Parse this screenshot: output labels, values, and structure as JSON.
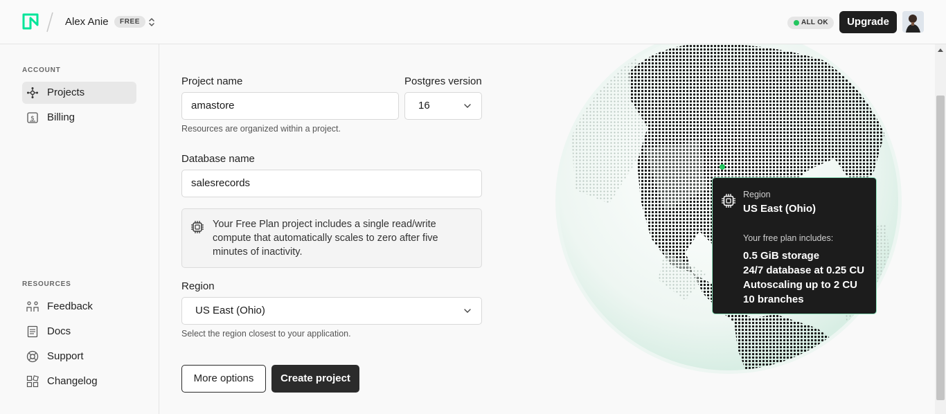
{
  "header": {
    "user_name": "Alex Anie",
    "plan_badge": "FREE",
    "status": "ALL OK",
    "upgrade_label": "Upgrade",
    "accent_color": "#00e599"
  },
  "sidebar": {
    "account_label": "ACCOUNT",
    "account_items": [
      {
        "label": "Projects",
        "icon": "projects-icon",
        "active": true
      },
      {
        "label": "Billing",
        "icon": "billing-icon",
        "active": false
      }
    ],
    "resources_label": "RESOURCES",
    "resource_items": [
      {
        "label": "Feedback",
        "icon": "feedback-icon"
      },
      {
        "label": "Docs",
        "icon": "docs-icon"
      },
      {
        "label": "Support",
        "icon": "support-icon"
      },
      {
        "label": "Changelog",
        "icon": "changelog-icon"
      }
    ]
  },
  "form": {
    "project_name_label": "Project name",
    "project_name_value": "amastore",
    "project_name_hint": "Resources are organized within a project.",
    "postgres_label": "Postgres version",
    "postgres_value": "16",
    "database_name_label": "Database name",
    "database_name_value": "salesrecords",
    "info_text": "Your Free Plan project includes a single read/write compute that automatically scales to zero after five minutes of inactivity.",
    "region_label": "Region",
    "region_value": "US East (Ohio)",
    "region_hint": "Select the region closest to your application.",
    "more_options_label": "More options",
    "create_label": "Create project"
  },
  "tooltip": {
    "label": "Region",
    "region": "US East (Ohio)",
    "subtitle": "Your free plan includes:",
    "items": [
      "0.5 GiB storage",
      "24/7 database at 0.25 CU",
      "Autoscaling up to 2 CU",
      "10 branches"
    ]
  }
}
